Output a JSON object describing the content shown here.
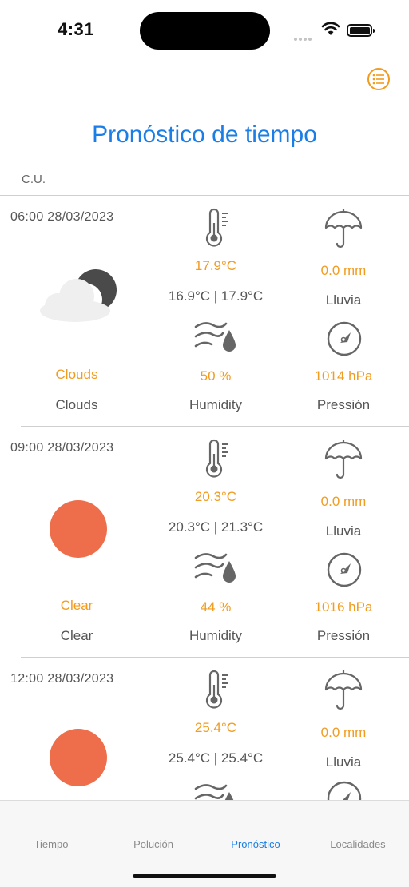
{
  "status": {
    "time": "4:31"
  },
  "header": {
    "title": "Pronóstico de tiempo",
    "city": "C.U."
  },
  "forecasts": [
    {
      "datetime": "06:00 28/03/2023",
      "temp": "17.9°C",
      "temp_range": "16.9°C | 17.9°C",
      "rain": "0.0 mm",
      "rain_label": "Lluvia",
      "weather_main": "Clouds",
      "weather_desc": "Clouds",
      "humidity": "50 %",
      "humidity_label": "Humidity",
      "pressure": "1014 hPa",
      "pressure_label": "Pressión",
      "icon": "cloud-moon-icon"
    },
    {
      "datetime": "09:00 28/03/2023",
      "temp": "20.3°C",
      "temp_range": "20.3°C | 21.3°C",
      "rain": "0.0 mm",
      "rain_label": "Lluvia",
      "weather_main": "Clear",
      "weather_desc": "Clear",
      "humidity": "44 %",
      "humidity_label": "Humidity",
      "pressure": "1016 hPa",
      "pressure_label": "Pressión",
      "icon": "sun-icon"
    },
    {
      "datetime": "12:00 28/03/2023",
      "temp": "25.4°C",
      "temp_range": "25.4°C | 25.4°C",
      "rain": "0.0 mm",
      "rain_label": "Lluvia",
      "icon": "sun-icon"
    }
  ],
  "tabs": [
    {
      "label": "Tiempo",
      "active": false
    },
    {
      "label": "Polución",
      "active": false
    },
    {
      "label": "Pronóstico",
      "active": true
    },
    {
      "label": "Localidades",
      "active": false
    }
  ],
  "colors": {
    "accent": "#1a7ee6",
    "highlight": "#f29c1f",
    "sun": "#ee6e4b"
  }
}
